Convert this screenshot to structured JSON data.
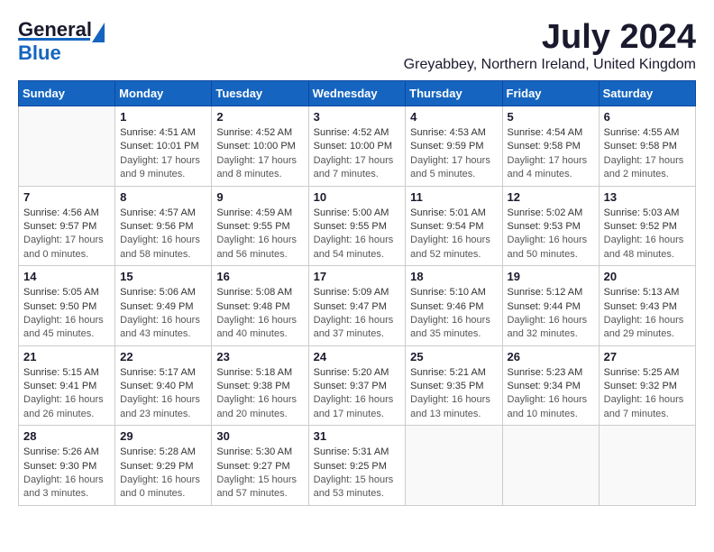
{
  "header": {
    "logo_general": "General",
    "logo_blue": "Blue",
    "month_year": "July 2024",
    "location": "Greyabbey, Northern Ireland, United Kingdom"
  },
  "days_of_week": [
    "Sunday",
    "Monday",
    "Tuesday",
    "Wednesday",
    "Thursday",
    "Friday",
    "Saturday"
  ],
  "weeks": [
    [
      {
        "day": "",
        "sunrise": "",
        "sunset": "",
        "daylight": ""
      },
      {
        "day": "1",
        "sunrise": "Sunrise: 4:51 AM",
        "sunset": "Sunset: 10:01 PM",
        "daylight": "Daylight: 17 hours and 9 minutes."
      },
      {
        "day": "2",
        "sunrise": "Sunrise: 4:52 AM",
        "sunset": "Sunset: 10:00 PM",
        "daylight": "Daylight: 17 hours and 8 minutes."
      },
      {
        "day": "3",
        "sunrise": "Sunrise: 4:52 AM",
        "sunset": "Sunset: 10:00 PM",
        "daylight": "Daylight: 17 hours and 7 minutes."
      },
      {
        "day": "4",
        "sunrise": "Sunrise: 4:53 AM",
        "sunset": "Sunset: 9:59 PM",
        "daylight": "Daylight: 17 hours and 5 minutes."
      },
      {
        "day": "5",
        "sunrise": "Sunrise: 4:54 AM",
        "sunset": "Sunset: 9:58 PM",
        "daylight": "Daylight: 17 hours and 4 minutes."
      },
      {
        "day": "6",
        "sunrise": "Sunrise: 4:55 AM",
        "sunset": "Sunset: 9:58 PM",
        "daylight": "Daylight: 17 hours and 2 minutes."
      }
    ],
    [
      {
        "day": "7",
        "sunrise": "Sunrise: 4:56 AM",
        "sunset": "Sunset: 9:57 PM",
        "daylight": "Daylight: 17 hours and 0 minutes."
      },
      {
        "day": "8",
        "sunrise": "Sunrise: 4:57 AM",
        "sunset": "Sunset: 9:56 PM",
        "daylight": "Daylight: 16 hours and 58 minutes."
      },
      {
        "day": "9",
        "sunrise": "Sunrise: 4:59 AM",
        "sunset": "Sunset: 9:55 PM",
        "daylight": "Daylight: 16 hours and 56 minutes."
      },
      {
        "day": "10",
        "sunrise": "Sunrise: 5:00 AM",
        "sunset": "Sunset: 9:55 PM",
        "daylight": "Daylight: 16 hours and 54 minutes."
      },
      {
        "day": "11",
        "sunrise": "Sunrise: 5:01 AM",
        "sunset": "Sunset: 9:54 PM",
        "daylight": "Daylight: 16 hours and 52 minutes."
      },
      {
        "day": "12",
        "sunrise": "Sunrise: 5:02 AM",
        "sunset": "Sunset: 9:53 PM",
        "daylight": "Daylight: 16 hours and 50 minutes."
      },
      {
        "day": "13",
        "sunrise": "Sunrise: 5:03 AM",
        "sunset": "Sunset: 9:52 PM",
        "daylight": "Daylight: 16 hours and 48 minutes."
      }
    ],
    [
      {
        "day": "14",
        "sunrise": "Sunrise: 5:05 AM",
        "sunset": "Sunset: 9:50 PM",
        "daylight": "Daylight: 16 hours and 45 minutes."
      },
      {
        "day": "15",
        "sunrise": "Sunrise: 5:06 AM",
        "sunset": "Sunset: 9:49 PM",
        "daylight": "Daylight: 16 hours and 43 minutes."
      },
      {
        "day": "16",
        "sunrise": "Sunrise: 5:08 AM",
        "sunset": "Sunset: 9:48 PM",
        "daylight": "Daylight: 16 hours and 40 minutes."
      },
      {
        "day": "17",
        "sunrise": "Sunrise: 5:09 AM",
        "sunset": "Sunset: 9:47 PM",
        "daylight": "Daylight: 16 hours and 37 minutes."
      },
      {
        "day": "18",
        "sunrise": "Sunrise: 5:10 AM",
        "sunset": "Sunset: 9:46 PM",
        "daylight": "Daylight: 16 hours and 35 minutes."
      },
      {
        "day": "19",
        "sunrise": "Sunrise: 5:12 AM",
        "sunset": "Sunset: 9:44 PM",
        "daylight": "Daylight: 16 hours and 32 minutes."
      },
      {
        "day": "20",
        "sunrise": "Sunrise: 5:13 AM",
        "sunset": "Sunset: 9:43 PM",
        "daylight": "Daylight: 16 hours and 29 minutes."
      }
    ],
    [
      {
        "day": "21",
        "sunrise": "Sunrise: 5:15 AM",
        "sunset": "Sunset: 9:41 PM",
        "daylight": "Daylight: 16 hours and 26 minutes."
      },
      {
        "day": "22",
        "sunrise": "Sunrise: 5:17 AM",
        "sunset": "Sunset: 9:40 PM",
        "daylight": "Daylight: 16 hours and 23 minutes."
      },
      {
        "day": "23",
        "sunrise": "Sunrise: 5:18 AM",
        "sunset": "Sunset: 9:38 PM",
        "daylight": "Daylight: 16 hours and 20 minutes."
      },
      {
        "day": "24",
        "sunrise": "Sunrise: 5:20 AM",
        "sunset": "Sunset: 9:37 PM",
        "daylight": "Daylight: 16 hours and 17 minutes."
      },
      {
        "day": "25",
        "sunrise": "Sunrise: 5:21 AM",
        "sunset": "Sunset: 9:35 PM",
        "daylight": "Daylight: 16 hours and 13 minutes."
      },
      {
        "day": "26",
        "sunrise": "Sunrise: 5:23 AM",
        "sunset": "Sunset: 9:34 PM",
        "daylight": "Daylight: 16 hours and 10 minutes."
      },
      {
        "day": "27",
        "sunrise": "Sunrise: 5:25 AM",
        "sunset": "Sunset: 9:32 PM",
        "daylight": "Daylight: 16 hours and 7 minutes."
      }
    ],
    [
      {
        "day": "28",
        "sunrise": "Sunrise: 5:26 AM",
        "sunset": "Sunset: 9:30 PM",
        "daylight": "Daylight: 16 hours and 3 minutes."
      },
      {
        "day": "29",
        "sunrise": "Sunrise: 5:28 AM",
        "sunset": "Sunset: 9:29 PM",
        "daylight": "Daylight: 16 hours and 0 minutes."
      },
      {
        "day": "30",
        "sunrise": "Sunrise: 5:30 AM",
        "sunset": "Sunset: 9:27 PM",
        "daylight": "Daylight: 15 hours and 57 minutes."
      },
      {
        "day": "31",
        "sunrise": "Sunrise: 5:31 AM",
        "sunset": "Sunset: 9:25 PM",
        "daylight": "Daylight: 15 hours and 53 minutes."
      },
      {
        "day": "",
        "sunrise": "",
        "sunset": "",
        "daylight": ""
      },
      {
        "day": "",
        "sunrise": "",
        "sunset": "",
        "daylight": ""
      },
      {
        "day": "",
        "sunrise": "",
        "sunset": "",
        "daylight": ""
      }
    ]
  ]
}
